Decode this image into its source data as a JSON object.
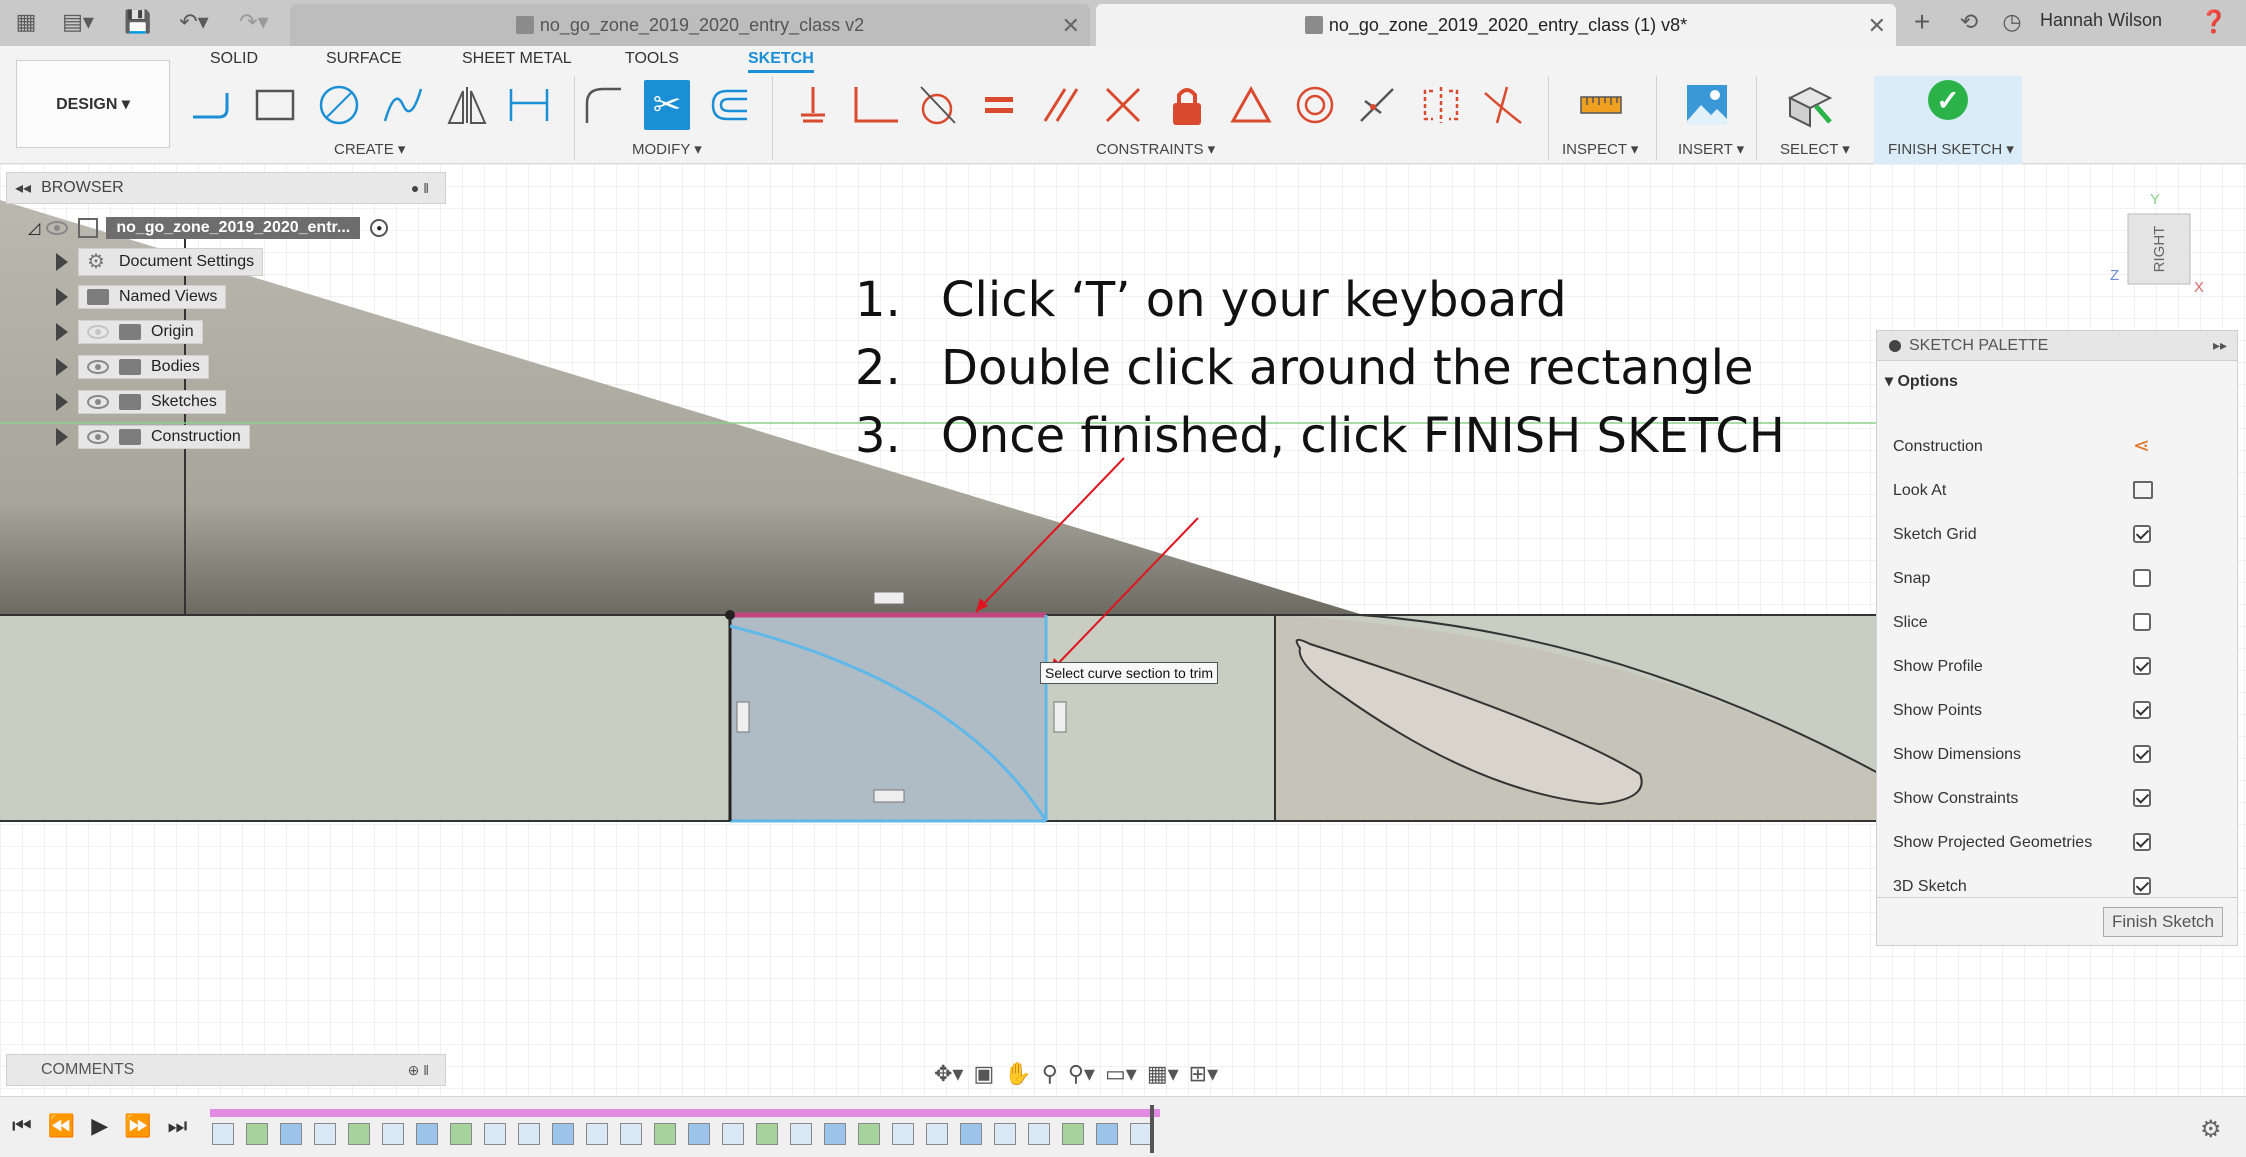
{
  "tabs": {
    "tab1_title": "no_go_zone_2019_2020_entry_class v2",
    "tab2_title": "no_go_zone_2019_2020_entry_class (1) v8*",
    "close_glyph": "✕",
    "add_glyph": "+"
  },
  "user": {
    "name": "Hannah Wilson"
  },
  "ribbon": {
    "tabs": [
      "SOLID",
      "SURFACE",
      "SHEET METAL",
      "TOOLS",
      "SKETCH"
    ],
    "design_label": "DESIGN ▾",
    "groups": {
      "create": "CREATE ▾",
      "modify": "MODIFY ▾",
      "constraints": "CONSTRAINTS ▾",
      "inspect": "INSPECT ▾",
      "insert": "INSERT ▾",
      "select": "SELECT ▾",
      "finish": "FINISH SKETCH ▾"
    }
  },
  "browser": {
    "header": "BROWSER",
    "root_label": "no_go_zone_2019_2020_entr...",
    "items": [
      "Document Settings",
      "Named Views",
      "Origin",
      "Bodies",
      "Sketches",
      "Construction"
    ]
  },
  "instructions": [
    {
      "num": "1.",
      "text": "Click ‘T’ on your keyboard"
    },
    {
      "num": "2.",
      "text": "Double click around the rectangle"
    },
    {
      "num": "3.",
      "text": "Once finished, click FINISH SKETCH"
    }
  ],
  "tooltip": "Select curve section to trim",
  "viewcube": {
    "face": "RIGHT",
    "axis_y": "Y",
    "axis_z": "Z",
    "axis_x": "X"
  },
  "palette": {
    "title": "SKETCH PALETTE",
    "options_label": "▾ Options",
    "rows": [
      {
        "label": "Construction",
        "kind": "icon"
      },
      {
        "label": "Look At",
        "kind": "icon"
      },
      {
        "label": "Sketch Grid",
        "kind": "check",
        "checked": true
      },
      {
        "label": "Snap",
        "kind": "check",
        "checked": false
      },
      {
        "label": "Slice",
        "kind": "check",
        "checked": false
      },
      {
        "label": "Show Profile",
        "kind": "check",
        "checked": true
      },
      {
        "label": "Show Points",
        "kind": "check",
        "checked": true
      },
      {
        "label": "Show Dimensions",
        "kind": "check",
        "checked": true
      },
      {
        "label": "Show Constraints",
        "kind": "check",
        "checked": true
      },
      {
        "label": "Show Projected Geometries",
        "kind": "check",
        "checked": true
      },
      {
        "label": "3D Sketch",
        "kind": "check",
        "checked": true
      }
    ],
    "finish_button": "Finish Sketch"
  },
  "comments": {
    "header": "COMMENTS"
  },
  "colors": {
    "accent": "#1a8fd6",
    "finish_check": "#2bb34a",
    "annotation_arrow": "#e0141e",
    "sketch_line": "#5fb8e8",
    "timeline_bar": "#e28adf"
  }
}
